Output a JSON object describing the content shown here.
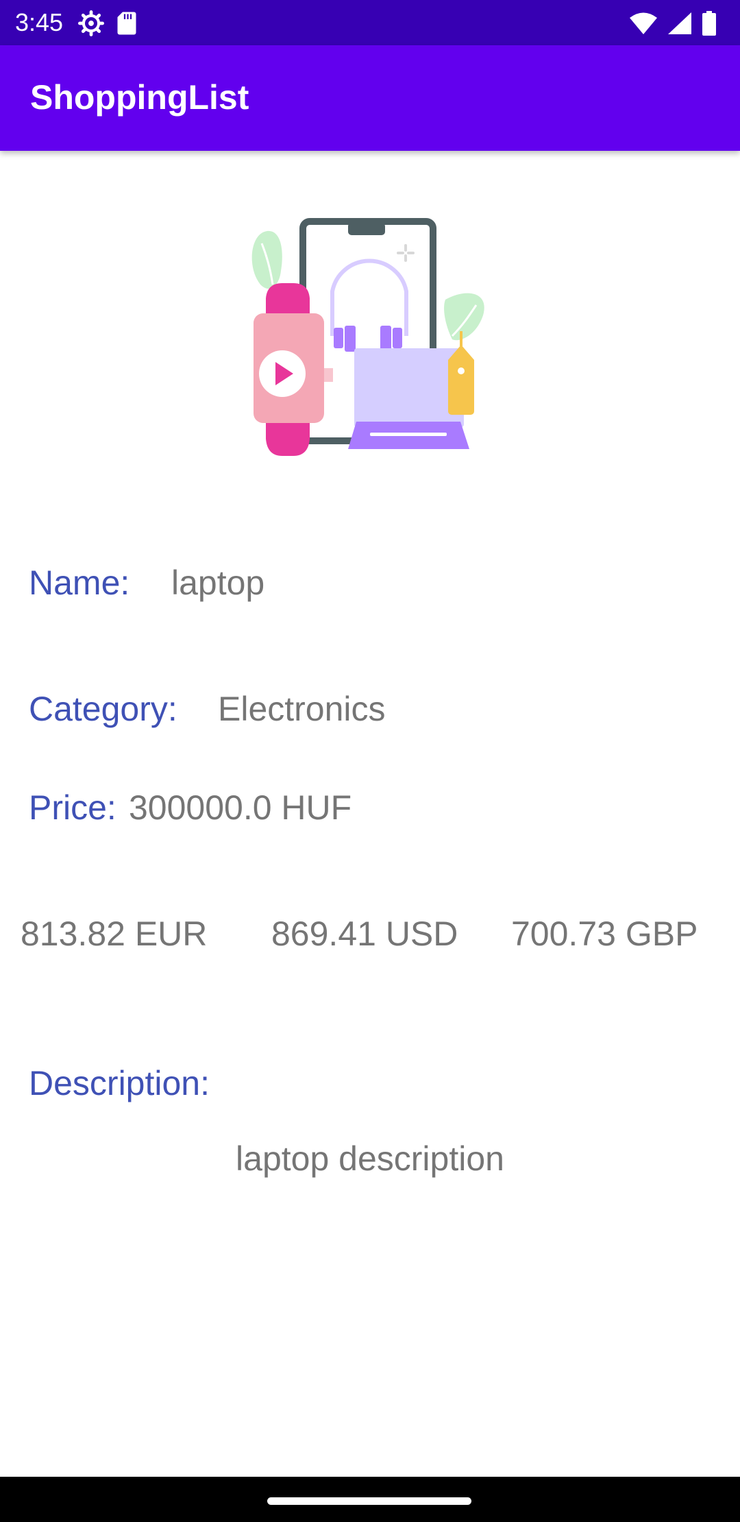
{
  "status_bar": {
    "time": "3:45",
    "left_icons": [
      "settings-icon",
      "sd-card-icon"
    ],
    "right_icons": [
      "wifi-icon",
      "signal-icon",
      "battery-icon"
    ]
  },
  "app_bar": {
    "title": "ShoppingList"
  },
  "item": {
    "illustration": "shopping-electronics-illustration",
    "name_label": "Name:",
    "name_value": "laptop",
    "category_label": "Category:",
    "category_value": "Electronics",
    "price_label": "Price:",
    "price_value": "300000.0 HUF",
    "conversions": {
      "eur": "813.82 EUR",
      "usd": "869.41 USD",
      "gbp": "700.73 GBP"
    },
    "description_label": "Description:",
    "description_value": "laptop description"
  },
  "colors": {
    "status_bar": "#3700b3",
    "app_bar": "#6200ee",
    "label": "#3f51b5",
    "value": "#757575"
  }
}
